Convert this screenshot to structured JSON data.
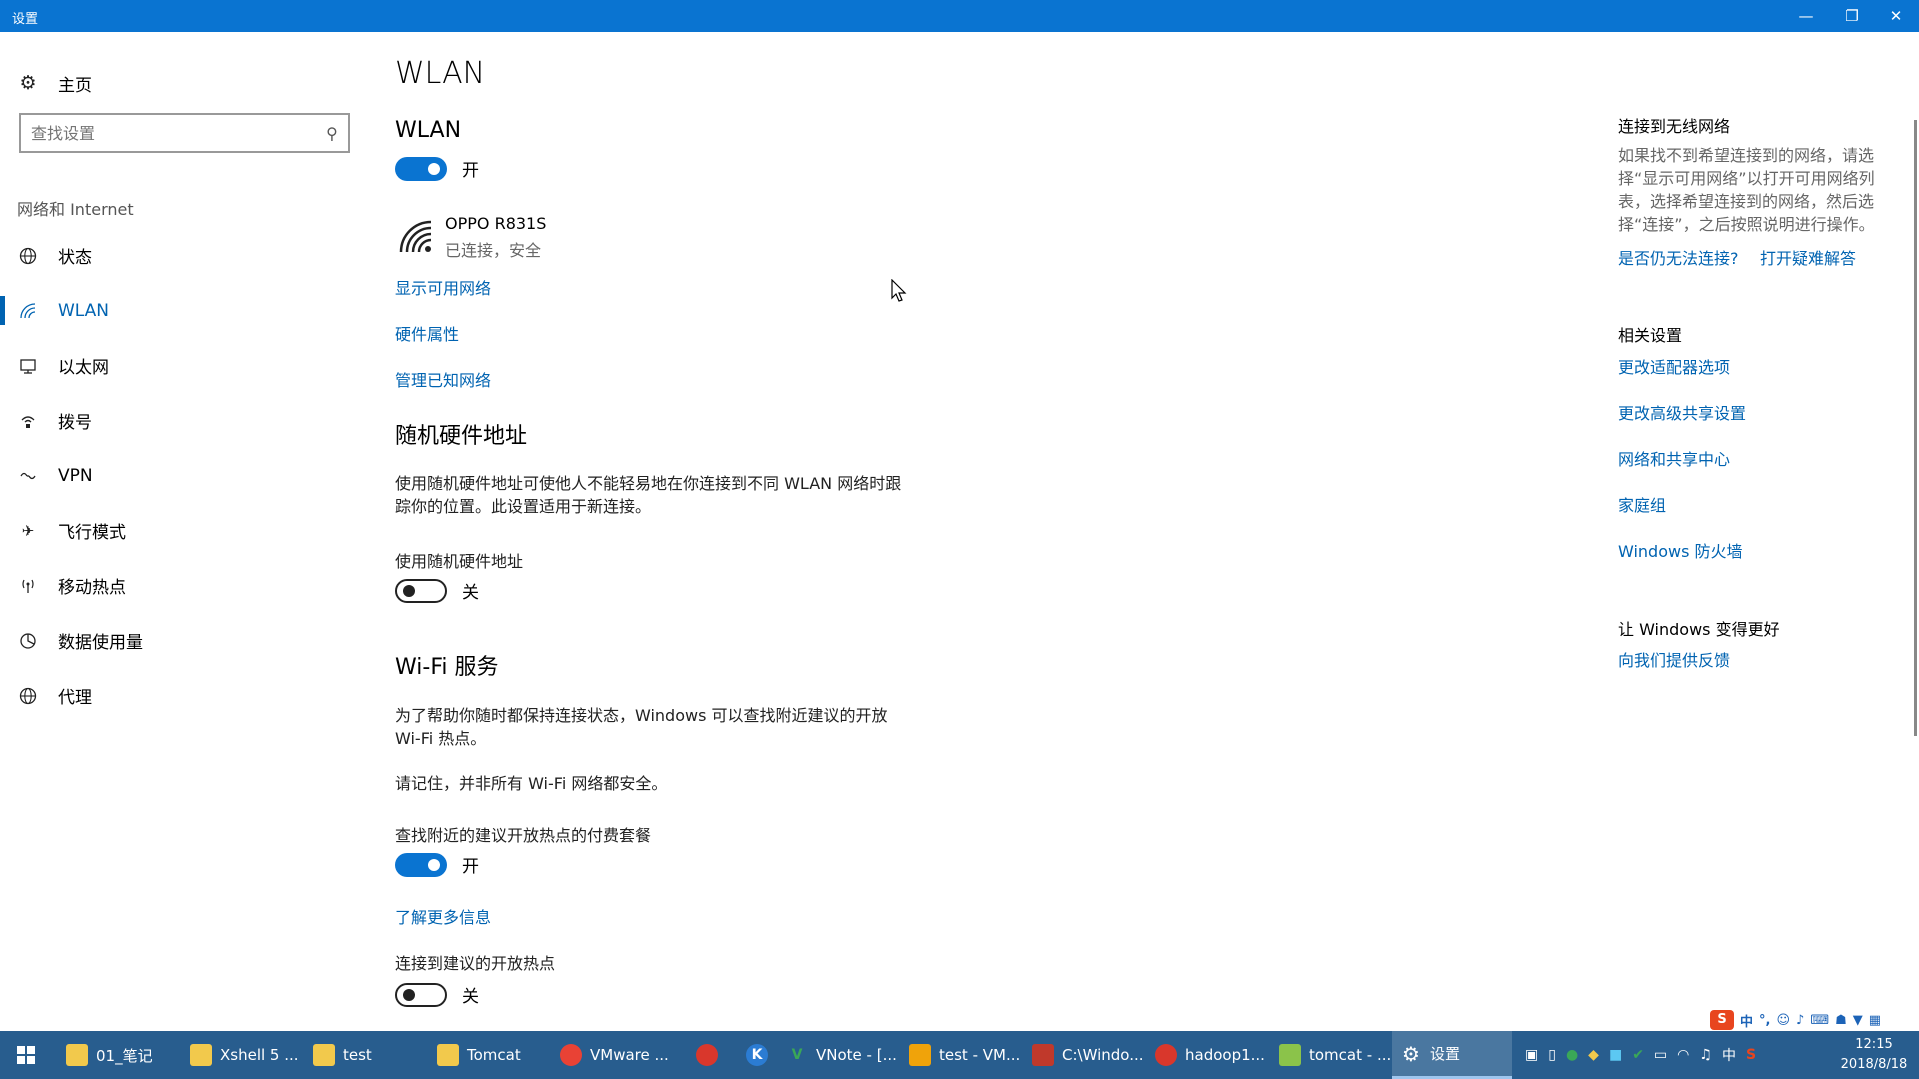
{
  "window": {
    "title": "设置"
  },
  "sidebar": {
    "home_label": "主页",
    "search_placeholder": "查找设置",
    "section_label": "网络和 Internet",
    "items": [
      {
        "label": "状态",
        "icon": "globe-icon"
      },
      {
        "label": "WLAN",
        "icon": "wifi-icon",
        "active": true
      },
      {
        "label": "以太网",
        "icon": "ethernet-icon"
      },
      {
        "label": "拨号",
        "icon": "dialup-icon"
      },
      {
        "label": "VPN",
        "icon": "vpn-icon"
      },
      {
        "label": "飞行模式",
        "icon": "airplane-icon"
      },
      {
        "label": "移动热点",
        "icon": "hotspot-icon"
      },
      {
        "label": "数据使用量",
        "icon": "data-usage-icon"
      },
      {
        "label": "代理",
        "icon": "globe-icon"
      }
    ]
  },
  "main": {
    "page_title": "WLAN",
    "wlan_heading": "WLAN",
    "wlan_toggle": "开",
    "network": {
      "name": "OPPO R831S",
      "status": "已连接，安全"
    },
    "links": {
      "show_networks": "显示可用网络",
      "hardware_properties": "硬件属性",
      "manage_known": "管理已知网络",
      "learn_more": "了解更多信息"
    },
    "random_hw": {
      "heading": "随机硬件地址",
      "description": "使用随机硬件地址可使他人不能轻易地在你连接到不同 WLAN 网络时跟踪你的位置。此设置适用于新连接。",
      "setting_label": "使用随机硬件地址",
      "toggle": "关"
    },
    "wifi_service": {
      "heading": "Wi-Fi 服务",
      "description": "为了帮助你随时都保持连接状态，Windows 可以查找附近建议的开放 Wi-Fi 热点。",
      "note": "请记住，并非所有 Wi-Fi 网络都安全。",
      "paid_label": "查找附近的建议开放热点的付费套餐",
      "paid_toggle": "开",
      "connect_label": "连接到建议的开放热点",
      "connect_toggle": "关"
    }
  },
  "right_panel": {
    "connect_heading": "连接到无线网络",
    "connect_description": "如果找不到希望连接到的网络，请选择“显示可用网络”以打开可用网络列表，选择希望连接到的网络，然后选择“连接”，之后按照说明进行操作。",
    "trouble_link_1": "是否仍无法连接?",
    "trouble_link_2": "打开疑难解答",
    "related_heading": "相关设置",
    "related_links": [
      "更改适配器选项",
      "更改高级共享设置",
      "网络和共享中心",
      "家庭组",
      "Windows 防火墙"
    ],
    "feedback_heading": "让 Windows 变得更好",
    "feedback_link": "向我们提供反馈"
  },
  "taskbar": {
    "items": [
      {
        "label": "01_笔记",
        "icon": "folder-icon",
        "color": "#f2c94c"
      },
      {
        "label": "Xshell 5 ...",
        "icon": "folder-icon",
        "color": "#f2c94c"
      },
      {
        "label": "test",
        "icon": "folder-icon",
        "color": "#f2c94c"
      },
      {
        "label": "Tomcat",
        "icon": "folder-icon",
        "color": "#f2c94c"
      },
      {
        "label": "VMware ...",
        "icon": "chrome-icon",
        "color": "#e94235"
      },
      {
        "label": "",
        "icon": "app-icon",
        "color": "#d9372c"
      },
      {
        "label": "",
        "icon": "k-icon",
        "color": "#2b7cd3"
      },
      {
        "label": "VNote - [...",
        "icon": "vnote-icon",
        "color": "#3aa757"
      },
      {
        "label": "test - VM...",
        "icon": "vmware-icon",
        "color": "#f0a30a"
      },
      {
        "label": "C:\\Windo...",
        "icon": "cmd-icon",
        "color": "#c0392b"
      },
      {
        "label": "hadoop1...",
        "icon": "xshell-icon",
        "color": "#d9372c"
      },
      {
        "label": "tomcat - ...",
        "icon": "xftp-icon",
        "color": "#8bc34a"
      },
      {
        "label": "设置",
        "icon": "gear-icon",
        "color": "#ffffff",
        "active": true
      }
    ],
    "tray_lang": "中",
    "clock_time": "12:15",
    "clock_date": "2018/8/18",
    "ime_label": "中"
  }
}
